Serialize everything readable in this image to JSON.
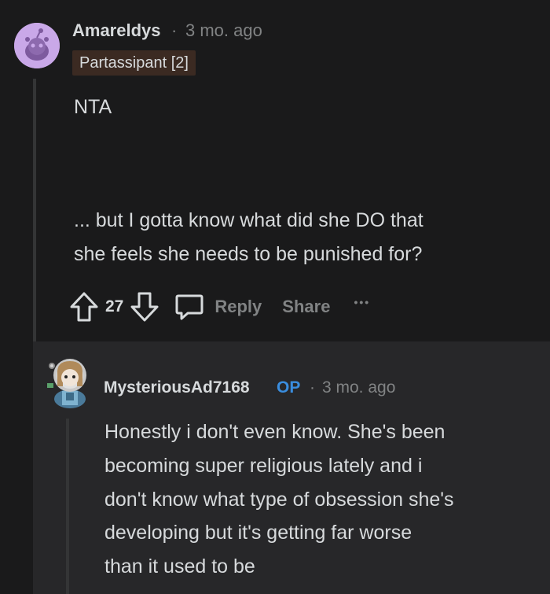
{
  "comment": {
    "author": "Amareldys",
    "separator": "·",
    "time": "3 mo. ago",
    "flair": "Partassipant [2]",
    "body_line1": "NTA",
    "body_line2": "... but I gotta know what did she DO that",
    "body_line3": "she feels she needs to be punished for?",
    "votes": "27",
    "reply_label": "Reply",
    "share_label": "Share",
    "more_label": "•••"
  },
  "reply": {
    "author": "MysteriousAd7168",
    "op_badge": "OP",
    "separator": "·",
    "time": "3 mo. ago",
    "lines": [
      "Honestly i don't even know. She's been",
      "becoming super religious lately and i",
      "don't know what type of obsession she's",
      "developing but it's getting far worse",
      "than it used to be"
    ]
  },
  "colors": {
    "background": "#1a1a1b",
    "reply_background": "#272729",
    "text": "#d7dadc",
    "muted": "#818384",
    "op_blue": "#3a8dde",
    "flair_bg": "#3b2a22"
  }
}
